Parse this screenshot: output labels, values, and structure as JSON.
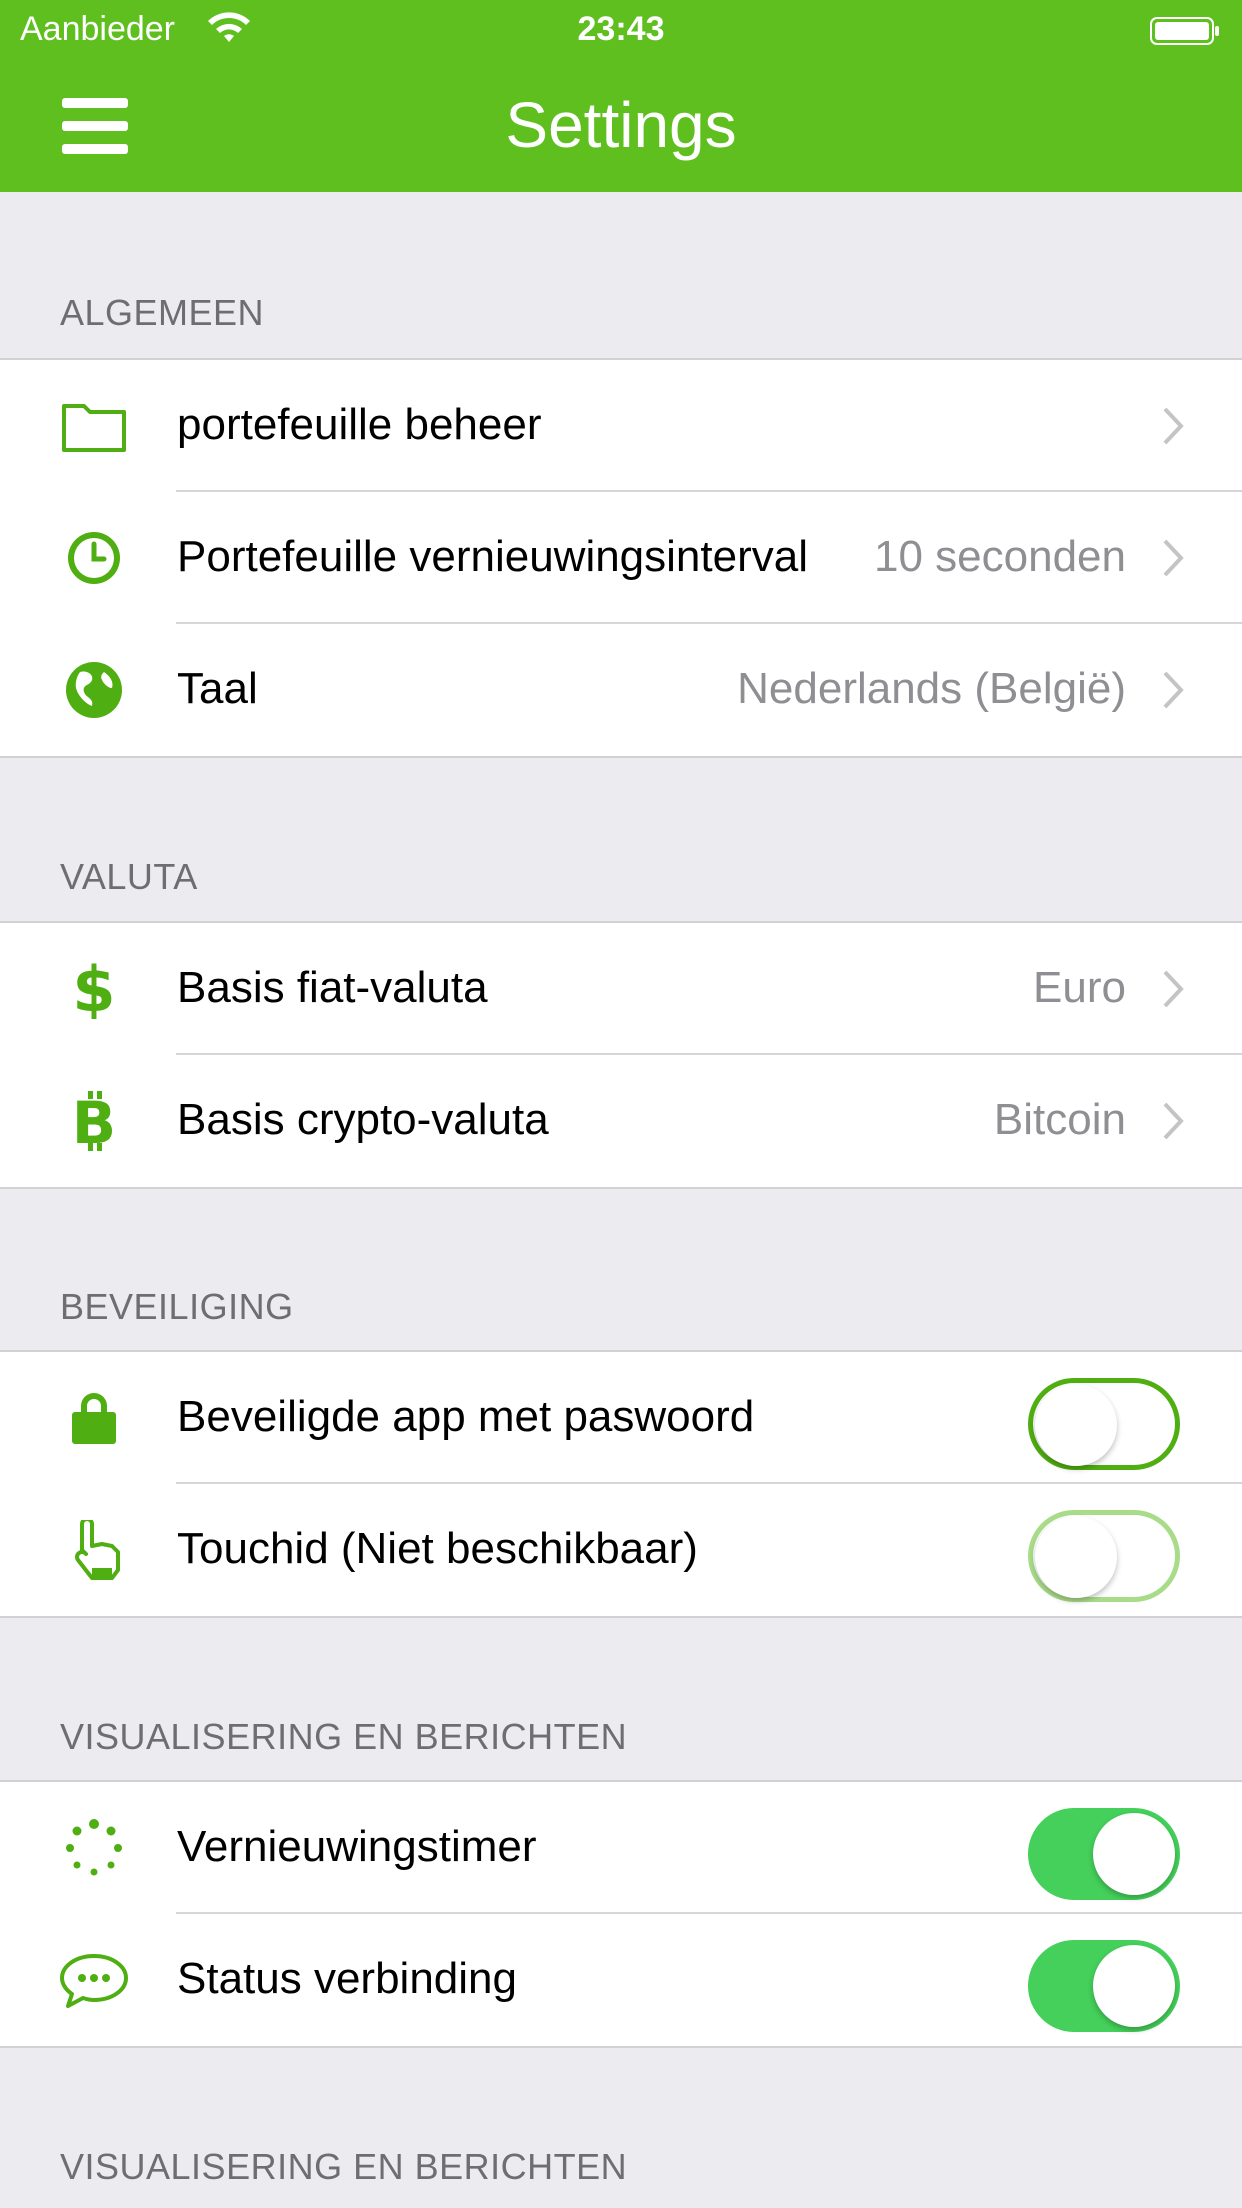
{
  "status_bar": {
    "carrier": "Aanbieder",
    "time": "23:43"
  },
  "nav": {
    "title": "Settings",
    "menu_icon": "hamburger-menu-icon"
  },
  "colors": {
    "brand": "#5ebf1f",
    "icon": "#4fae11",
    "toggle_on": "#44d05a"
  },
  "sections": {
    "algemeen": {
      "header": "ALGEMEEN",
      "rows": [
        {
          "icon": "folder-icon",
          "label": "portefeuille beheer",
          "value": ""
        },
        {
          "icon": "clock-icon",
          "label": "Portefeuille vernieuwingsinterval",
          "value": "10 seconden"
        },
        {
          "icon": "globe-icon",
          "label": "Taal",
          "value": "Nederlands (België)"
        }
      ]
    },
    "valuta": {
      "header": "VALUTA",
      "rows": [
        {
          "icon": "dollar-icon",
          "label": "Basis fiat-valuta",
          "value": "Euro"
        },
        {
          "icon": "bitcoin-icon",
          "label": "Basis crypto-valuta",
          "value": "Bitcoin"
        }
      ]
    },
    "beveiliging": {
      "header": "BEVEILIGING",
      "rows": [
        {
          "icon": "lock-icon",
          "label": "Beveiligde app met paswoord",
          "toggle": false,
          "enabled": true
        },
        {
          "icon": "touch-hand-icon",
          "label": "Touchid (Niet beschikbaar)",
          "toggle": false,
          "enabled": false
        }
      ]
    },
    "visualisering": {
      "header": "VISUALISERING EN BERICHTEN",
      "rows": [
        {
          "icon": "spinner-icon",
          "label": "Vernieuwingstimer",
          "toggle": true
        },
        {
          "icon": "chat-bubble-icon",
          "label": "Status verbinding",
          "toggle": true
        }
      ]
    },
    "visualisering2": {
      "header": "VISUALISERING EN BERICHTEN"
    }
  }
}
